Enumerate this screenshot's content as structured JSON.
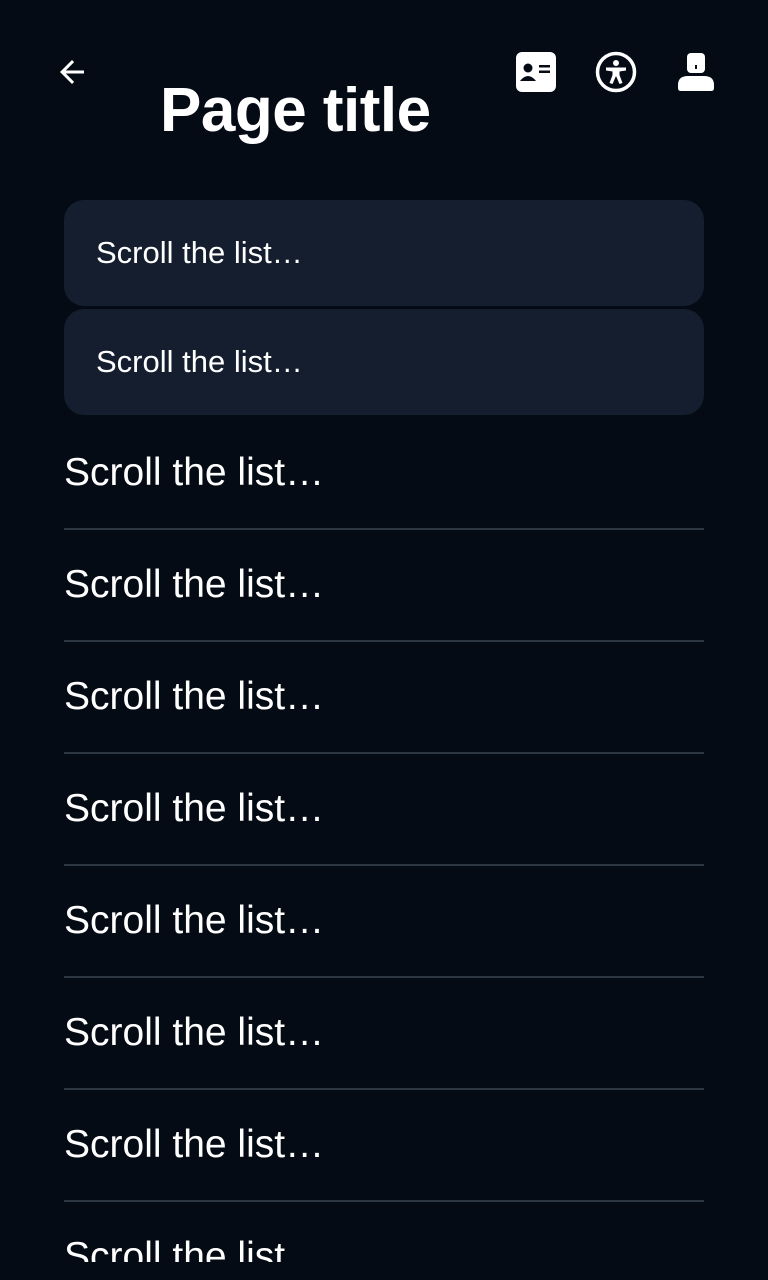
{
  "header": {
    "back_icon": "arrow-left-icon",
    "title": "Page title",
    "actions": [
      {
        "name": "contact-card-icon"
      },
      {
        "name": "accessibility-icon"
      },
      {
        "name": "account-icon"
      }
    ]
  },
  "list": {
    "card_items": [
      {
        "label": "Scroll the list…"
      },
      {
        "label": "Scroll the list…"
      }
    ],
    "row_items": [
      {
        "label": "Scroll the list…"
      },
      {
        "label": "Scroll the list…"
      },
      {
        "label": "Scroll the list…"
      },
      {
        "label": "Scroll the list…"
      },
      {
        "label": "Scroll the list…"
      },
      {
        "label": "Scroll the list…"
      },
      {
        "label": "Scroll the list…"
      },
      {
        "label": "Scroll the list…"
      }
    ]
  },
  "colors": {
    "background": "#040b14",
    "card": "#141e2e",
    "divider": "#2c3542",
    "text": "#ffffff"
  }
}
